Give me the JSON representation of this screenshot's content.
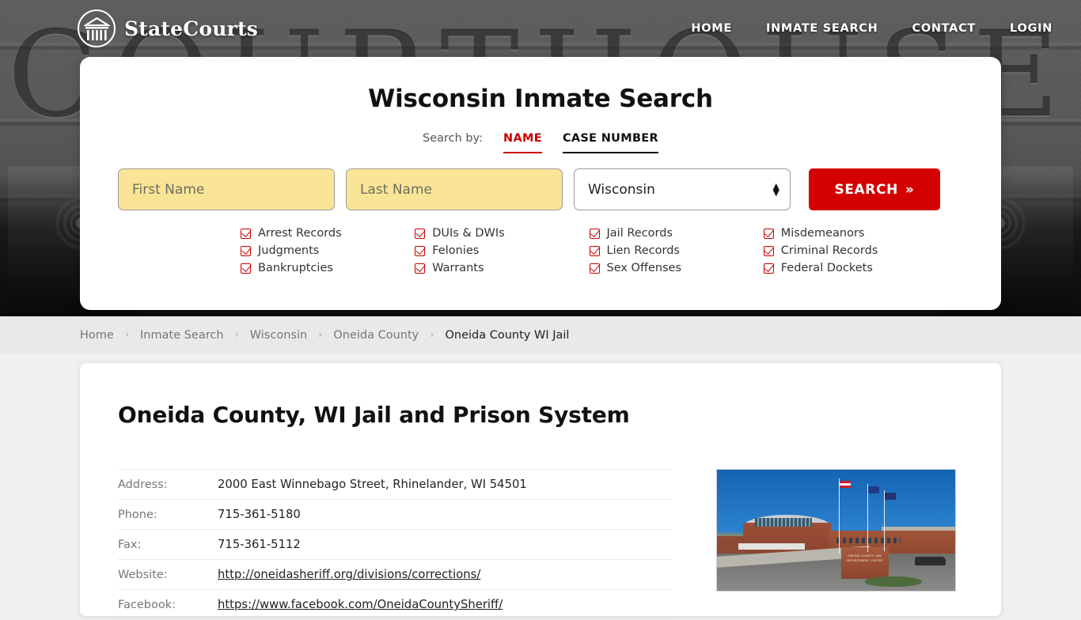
{
  "brand": {
    "name": "StateCourts",
    "logo_icon": "courthouse-circle-icon"
  },
  "nav": {
    "items": [
      {
        "label": "HOME"
      },
      {
        "label": "INMATE SEARCH"
      },
      {
        "label": "CONTACT"
      },
      {
        "label": "LOGIN"
      }
    ]
  },
  "hero": {
    "background_word": "COURTHOUSE"
  },
  "search_card": {
    "title": "Wisconsin Inmate Search",
    "search_by_label": "Search by:",
    "tabs": [
      {
        "label": "NAME",
        "active": true
      },
      {
        "label": "CASE NUMBER",
        "active": false
      }
    ],
    "first_name_placeholder": "First Name",
    "first_name_value": "",
    "last_name_placeholder": "Last Name",
    "last_name_value": "",
    "state_selected": "Wisconsin",
    "state_options": [
      "Wisconsin"
    ],
    "search_button": "SEARCH",
    "search_button_icon": "double-chevron-right-icon",
    "accent_color": "#d40000",
    "field_background": "#fae596",
    "record_types": [
      "Arrest Records",
      "DUIs & DWIs",
      "Jail Records",
      "Misdemeanors",
      "Judgments",
      "Felonies",
      "Lien Records",
      "Criminal Records",
      "Bankruptcies",
      "Warrants",
      "Sex Offenses",
      "Federal Dockets"
    ]
  },
  "breadcrumb": {
    "separator": "›",
    "items": [
      {
        "label": "Home",
        "current": false
      },
      {
        "label": "Inmate Search",
        "current": false
      },
      {
        "label": "Wisconsin",
        "current": false
      },
      {
        "label": "Oneida County",
        "current": false
      },
      {
        "label": "Oneida County WI Jail",
        "current": true
      }
    ]
  },
  "main": {
    "title": "Oneida County, WI Jail and Prison System",
    "details": [
      {
        "label": "Address:",
        "value": "2000 East Winnebago Street, Rhinelander, WI 54501",
        "link": false
      },
      {
        "label": "Phone:",
        "value": "715-361-5180",
        "link": false
      },
      {
        "label": "Fax:",
        "value": "715-361-5112",
        "link": false
      },
      {
        "label": "Website:",
        "value": "http://oneidasheriff.org/divisions/corrections/",
        "link": true
      },
      {
        "label": "Facebook:",
        "value": "https://www.facebook.com/OneidaCountySheriff/",
        "link": true
      }
    ],
    "photo_caption": "ONEIDA COUNTY LAW ENFORCEMENT CENTER"
  }
}
